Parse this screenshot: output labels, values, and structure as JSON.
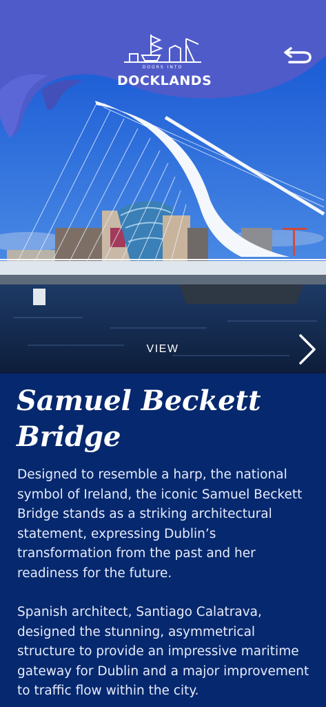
{
  "header": {
    "logo_small_text": "DOORS INTO",
    "logo_wordmark": "DOCKLANDS"
  },
  "hero": {
    "view_label": "VIEW",
    "next_icon": "chevron-right-icon",
    "back_icon": "undo-arrow-icon"
  },
  "content": {
    "title_line1": "Samuel Beckett",
    "title_line2": "Bridge",
    "paragraphs": [
      "Designed to resemble a harp, the national symbol of Ireland, the iconic Samuel Beckett Bridge stands as a striking architectural statement, expressing Dublin’s transformation from the past and her readiness for the future.",
      "Spanish architect, Santiago Calatrava, designed the stunning, asymmetrical structure to provide an impressive maritime gateway for Dublin and a major improvement to traffic flow within the city."
    ]
  },
  "colors": {
    "header_wave": "#4f5bc9",
    "page_background": "#06286e",
    "sky": "#1f63d6"
  }
}
